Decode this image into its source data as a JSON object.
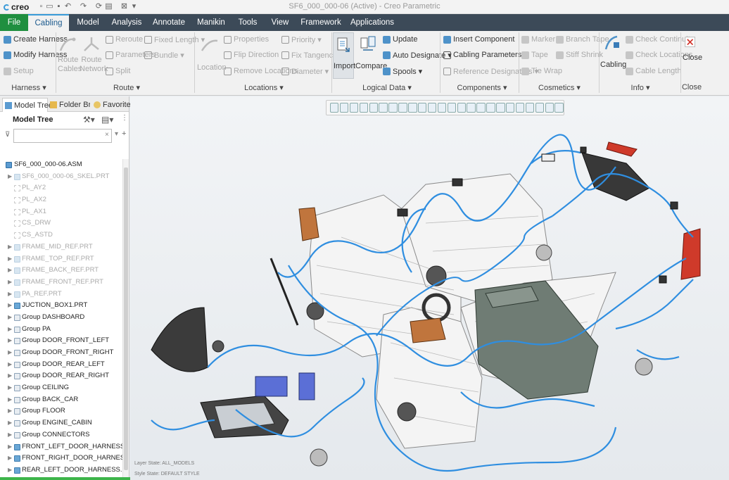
{
  "app": {
    "logo": "creo",
    "window_title": "SF6_000_000-06 (Active) - Creo Parametric"
  },
  "ribbon_tabs": [
    "File",
    "Cabling",
    "Model",
    "Analysis",
    "Annotate",
    "Manikin",
    "Tools",
    "View",
    "Framework",
    "Applications"
  ],
  "ribbon": {
    "harness": {
      "create": "Create Harness",
      "modify": "Modify Harness",
      "setup": "Setup",
      "label": "Harness"
    },
    "route": {
      "route_cables": "Route Cables",
      "route_network": "Route Network",
      "reroute": "Reroute",
      "parameters": "Parameters",
      "split": "Split",
      "fixed_length": "Fixed Length",
      "bundle": "Bundle",
      "label": "Route"
    },
    "locations": {
      "location": "Location",
      "properties": "Properties",
      "flip_direction": "Flip Direction",
      "remove_locations": "Remove Locations",
      "priority": "Priority",
      "fix_tangency": "Fix Tangency",
      "diameter": "Diameter",
      "label": "Locations"
    },
    "logical_data": {
      "import": "Import",
      "compare": "Compare",
      "update": "Update",
      "auto_designate": "Auto Designate",
      "spools": "Spools",
      "label": "Logical Data"
    },
    "components": {
      "insert_component": "Insert Component",
      "cabling_parameters": "Cabling Parameters",
      "reference_designators": "Reference Designators",
      "label": "Components"
    },
    "cosmetics": {
      "marker": "Marker",
      "tape": "Tape",
      "tie_wrap": "Tie Wrap",
      "branch_tape": "Branch Tape",
      "stiff_shrink": "Stiff Shrink",
      "label": "Cosmetics"
    },
    "info": {
      "cabling": "Cabling",
      "check_continuity": "Check Continuity",
      "check_locations": "Check Locations",
      "cable_length": "Cable Length",
      "label": "Info"
    },
    "close": {
      "button": "Close",
      "label": "Close"
    }
  },
  "left_panel": {
    "tabs": [
      "Model Tree",
      "Folder Bro",
      "Favorites"
    ],
    "title": "Model Tree",
    "filter_placeholder": "",
    "tree": [
      {
        "label": "SF6_000_000-06.ASM",
        "kind": "asm",
        "expand": false,
        "dim": false
      },
      {
        "label": "SF6_000_000-06_SKEL.PRT",
        "kind": "dpart",
        "expand": true,
        "dim": true
      },
      {
        "label": "PL_AY2",
        "kind": "datum",
        "expand": false,
        "dim": true
      },
      {
        "label": "PL_AX2",
        "kind": "datum",
        "expand": false,
        "dim": true
      },
      {
        "label": "PL_AX1",
        "kind": "datum",
        "expand": false,
        "dim": true
      },
      {
        "label": "CS_DRW",
        "kind": "datum",
        "expand": false,
        "dim": true
      },
      {
        "label": "CS_ASTD",
        "kind": "datum",
        "expand": false,
        "dim": true
      },
      {
        "label": "FRAME_MID_REF.PRT",
        "kind": "dpart",
        "expand": true,
        "dim": true
      },
      {
        "label": "FRAME_TOP_REF.PRT",
        "kind": "dpart",
        "expand": true,
        "dim": true
      },
      {
        "label": "FRAME_BACK_REF.PRT",
        "kind": "dpart",
        "expand": true,
        "dim": true
      },
      {
        "label": "FRAME_FRONT_REF.PRT",
        "kind": "dpart",
        "expand": true,
        "dim": true
      },
      {
        "label": "PA_REF.PRT",
        "kind": "dpart",
        "expand": true,
        "dim": true
      },
      {
        "label": "JUCTION_BOX1.PRT",
        "kind": "part",
        "expand": true,
        "dim": false
      },
      {
        "label": "Group DASHBOARD",
        "kind": "grp",
        "expand": true,
        "dim": false
      },
      {
        "label": "Group PA",
        "kind": "grp",
        "expand": true,
        "dim": false
      },
      {
        "label": "Group DOOR_FRONT_LEFT",
        "kind": "grp",
        "expand": true,
        "dim": false
      },
      {
        "label": "Group DOOR_FRONT_RIGHT",
        "kind": "grp",
        "expand": true,
        "dim": false
      },
      {
        "label": "Group DOOR_REAR_LEFT",
        "kind": "grp",
        "expand": true,
        "dim": false
      },
      {
        "label": "Group DOOR_REAR_RIGHT",
        "kind": "grp",
        "expand": true,
        "dim": false
      },
      {
        "label": "Group CEILING",
        "kind": "grp",
        "expand": true,
        "dim": false
      },
      {
        "label": "Group BACK_CAR",
        "kind": "grp",
        "expand": true,
        "dim": false
      },
      {
        "label": "Group FLOOR",
        "kind": "grp",
        "expand": true,
        "dim": false
      },
      {
        "label": "Group ENGINE_CABIN",
        "kind": "grp",
        "expand": true,
        "dim": false
      },
      {
        "label": "Group CONNECTORS",
        "kind": "grp",
        "expand": true,
        "dim": false
      },
      {
        "label": "FRONT_LEFT_DOOR_HARNESS.PRT",
        "kind": "part",
        "expand": true,
        "dim": false
      },
      {
        "label": "FRONT_RIGHT_DOOR_HARNESS.PRT",
        "kind": "part",
        "expand": true,
        "dim": false
      },
      {
        "label": "REAR_LEFT_DOOR_HARNESS.PRT",
        "kind": "part",
        "expand": true,
        "dim": false
      }
    ]
  },
  "graphics": {
    "layer_state": "Layer State: ALL_MODELS",
    "style_state": "Style State: DEFAULT STYLE",
    "harness_color": "#2f8ee0"
  }
}
